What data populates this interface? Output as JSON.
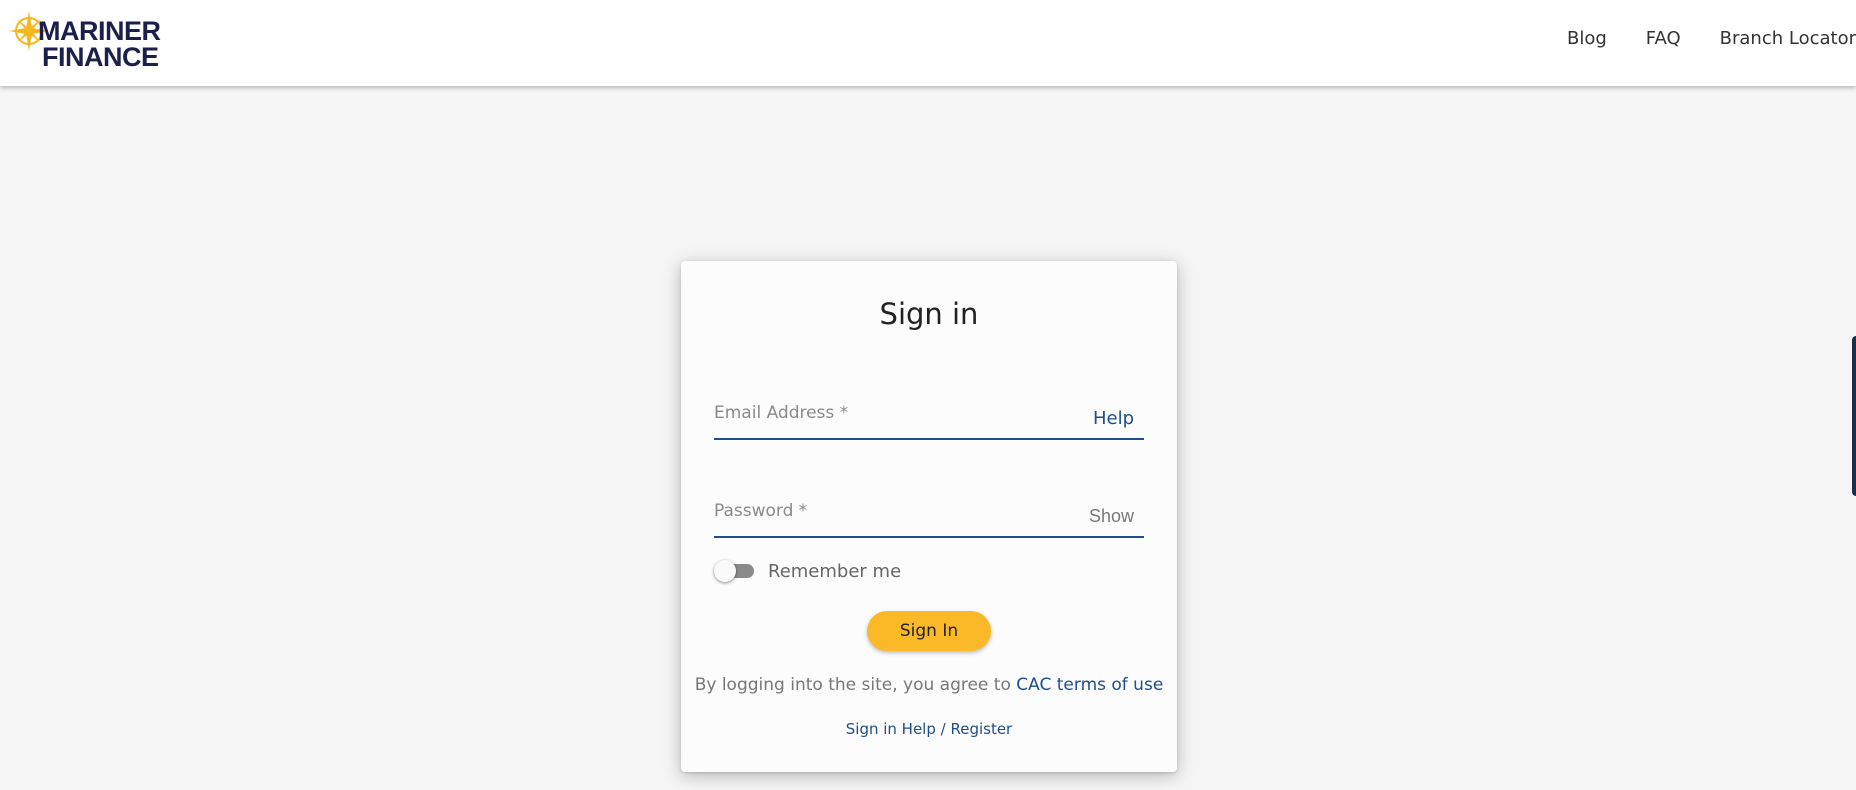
{
  "brand": {
    "line1": "MARINER",
    "line2": "FINANCE",
    "colors": {
      "navy": "#1b1f4a",
      "gold": "#f5b81c"
    }
  },
  "nav": {
    "items": [
      {
        "label": "Blog"
      },
      {
        "label": "FAQ"
      },
      {
        "label": "Branch Locator"
      }
    ]
  },
  "signin": {
    "title": "Sign in",
    "email": {
      "placeholder": "Email Address *",
      "value": "",
      "adornment": "Help"
    },
    "password": {
      "placeholder": "Password *",
      "value": "",
      "adornment": "Show"
    },
    "remember": {
      "label": "Remember me",
      "checked": false
    },
    "button": "Sign In",
    "terms": {
      "text": "By logging into the site, you agree to ",
      "link": "CAC terms of use"
    },
    "help_register": "Sign in Help / Register"
  },
  "colors": {
    "accent_blue": "#1f4e8c",
    "button_yellow": "#fbb927",
    "background": "#f5f5f5"
  },
  "icons": {
    "logo": "compass-icon"
  }
}
